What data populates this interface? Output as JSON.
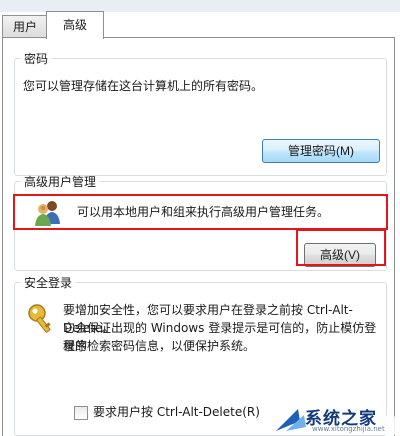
{
  "tabs": {
    "user": "用户",
    "advanced": "高级"
  },
  "passwords": {
    "legend": "密码",
    "text": "您可以管理存储在这台计算机上的所有密码。",
    "button": "管理密码(M)"
  },
  "advanced_user": {
    "legend": "高级用户管理",
    "text": "可以用本地用户和组来执行高级用户管理任务。",
    "button": "高级(V)"
  },
  "secure_logon": {
    "legend": "安全登录",
    "text_line1": "要增加安全性，您可以要求用户在登录之前按 Ctrl-Alt-Delete。",
    "text_line2": "它会保证出现的 Windows 登录提示是可信的，防止模仿登录的",
    "text_line3": "程序检索密码信息，以便保护系统。",
    "checkbox_label": "要求用户按 Ctrl-Alt-Delete(R)"
  },
  "watermark": {
    "brand": "系统之家",
    "url": "www.xitongzhijia.net"
  },
  "colors": {
    "highlight": "#e0181e",
    "button_accent": "#3c7fb1"
  }
}
